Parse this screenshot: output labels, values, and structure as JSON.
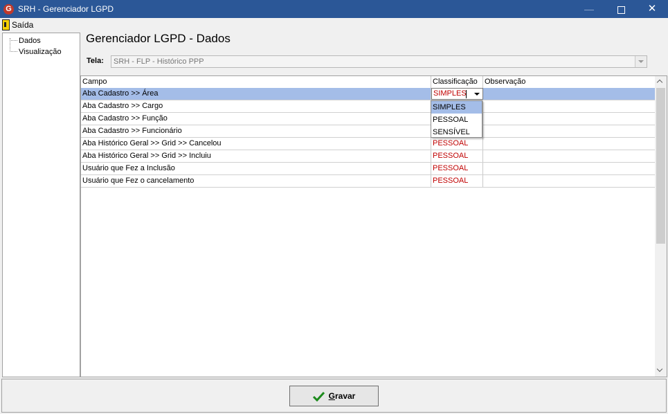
{
  "window": {
    "app_icon_letter": "G",
    "title": "SRH - Gerenciador LGPD",
    "min_glyph": "—",
    "close_glyph": "✕"
  },
  "menu": {
    "items": [
      {
        "label": "Saída"
      }
    ]
  },
  "tree": {
    "items": [
      {
        "label": "Dados"
      },
      {
        "label": "Visualização"
      }
    ]
  },
  "main": {
    "heading": "Gerenciador LGPD - Dados",
    "tela_label": "Tela:",
    "tela_value": "SRH - FLP - Histórico PPP"
  },
  "grid": {
    "columns": [
      "Campo",
      "Classificação",
      "Observação"
    ],
    "rows": [
      {
        "campo": "Aba Cadastro >> Área",
        "classificacao": "SIMPLES",
        "observacao": ""
      },
      {
        "campo": "Aba Cadastro >> Cargo",
        "classificacao": "",
        "observacao": ""
      },
      {
        "campo": "Aba Cadastro >> Função",
        "classificacao": "",
        "observacao": ""
      },
      {
        "campo": "Aba Cadastro >> Funcionário",
        "classificacao": "",
        "observacao": ""
      },
      {
        "campo": "Aba Histórico Geral >> Grid >> Cancelou",
        "classificacao": "PESSOAL",
        "observacao": ""
      },
      {
        "campo": "Aba Histórico Geral >> Grid >> Incluiu",
        "classificacao": "PESSOAL",
        "observacao": ""
      },
      {
        "campo": "Usuário que Fez a Inclusão",
        "classificacao": "PESSOAL",
        "observacao": ""
      },
      {
        "campo": "Usuário que Fez o cancelamento",
        "classificacao": "PESSOAL",
        "observacao": ""
      }
    ],
    "dropdown_options": [
      "SIMPLES",
      "PESSOAL",
      "SENSÍVEL"
    ],
    "dropdown_selected": "SIMPLES"
  },
  "footer": {
    "gravar_underlined": "G",
    "gravar_rest": "ravar"
  },
  "colors": {
    "titlebar": "#2b5797",
    "selection": "#a4bde8",
    "classification_text": "#c00000",
    "check": "#1c8a1c"
  }
}
